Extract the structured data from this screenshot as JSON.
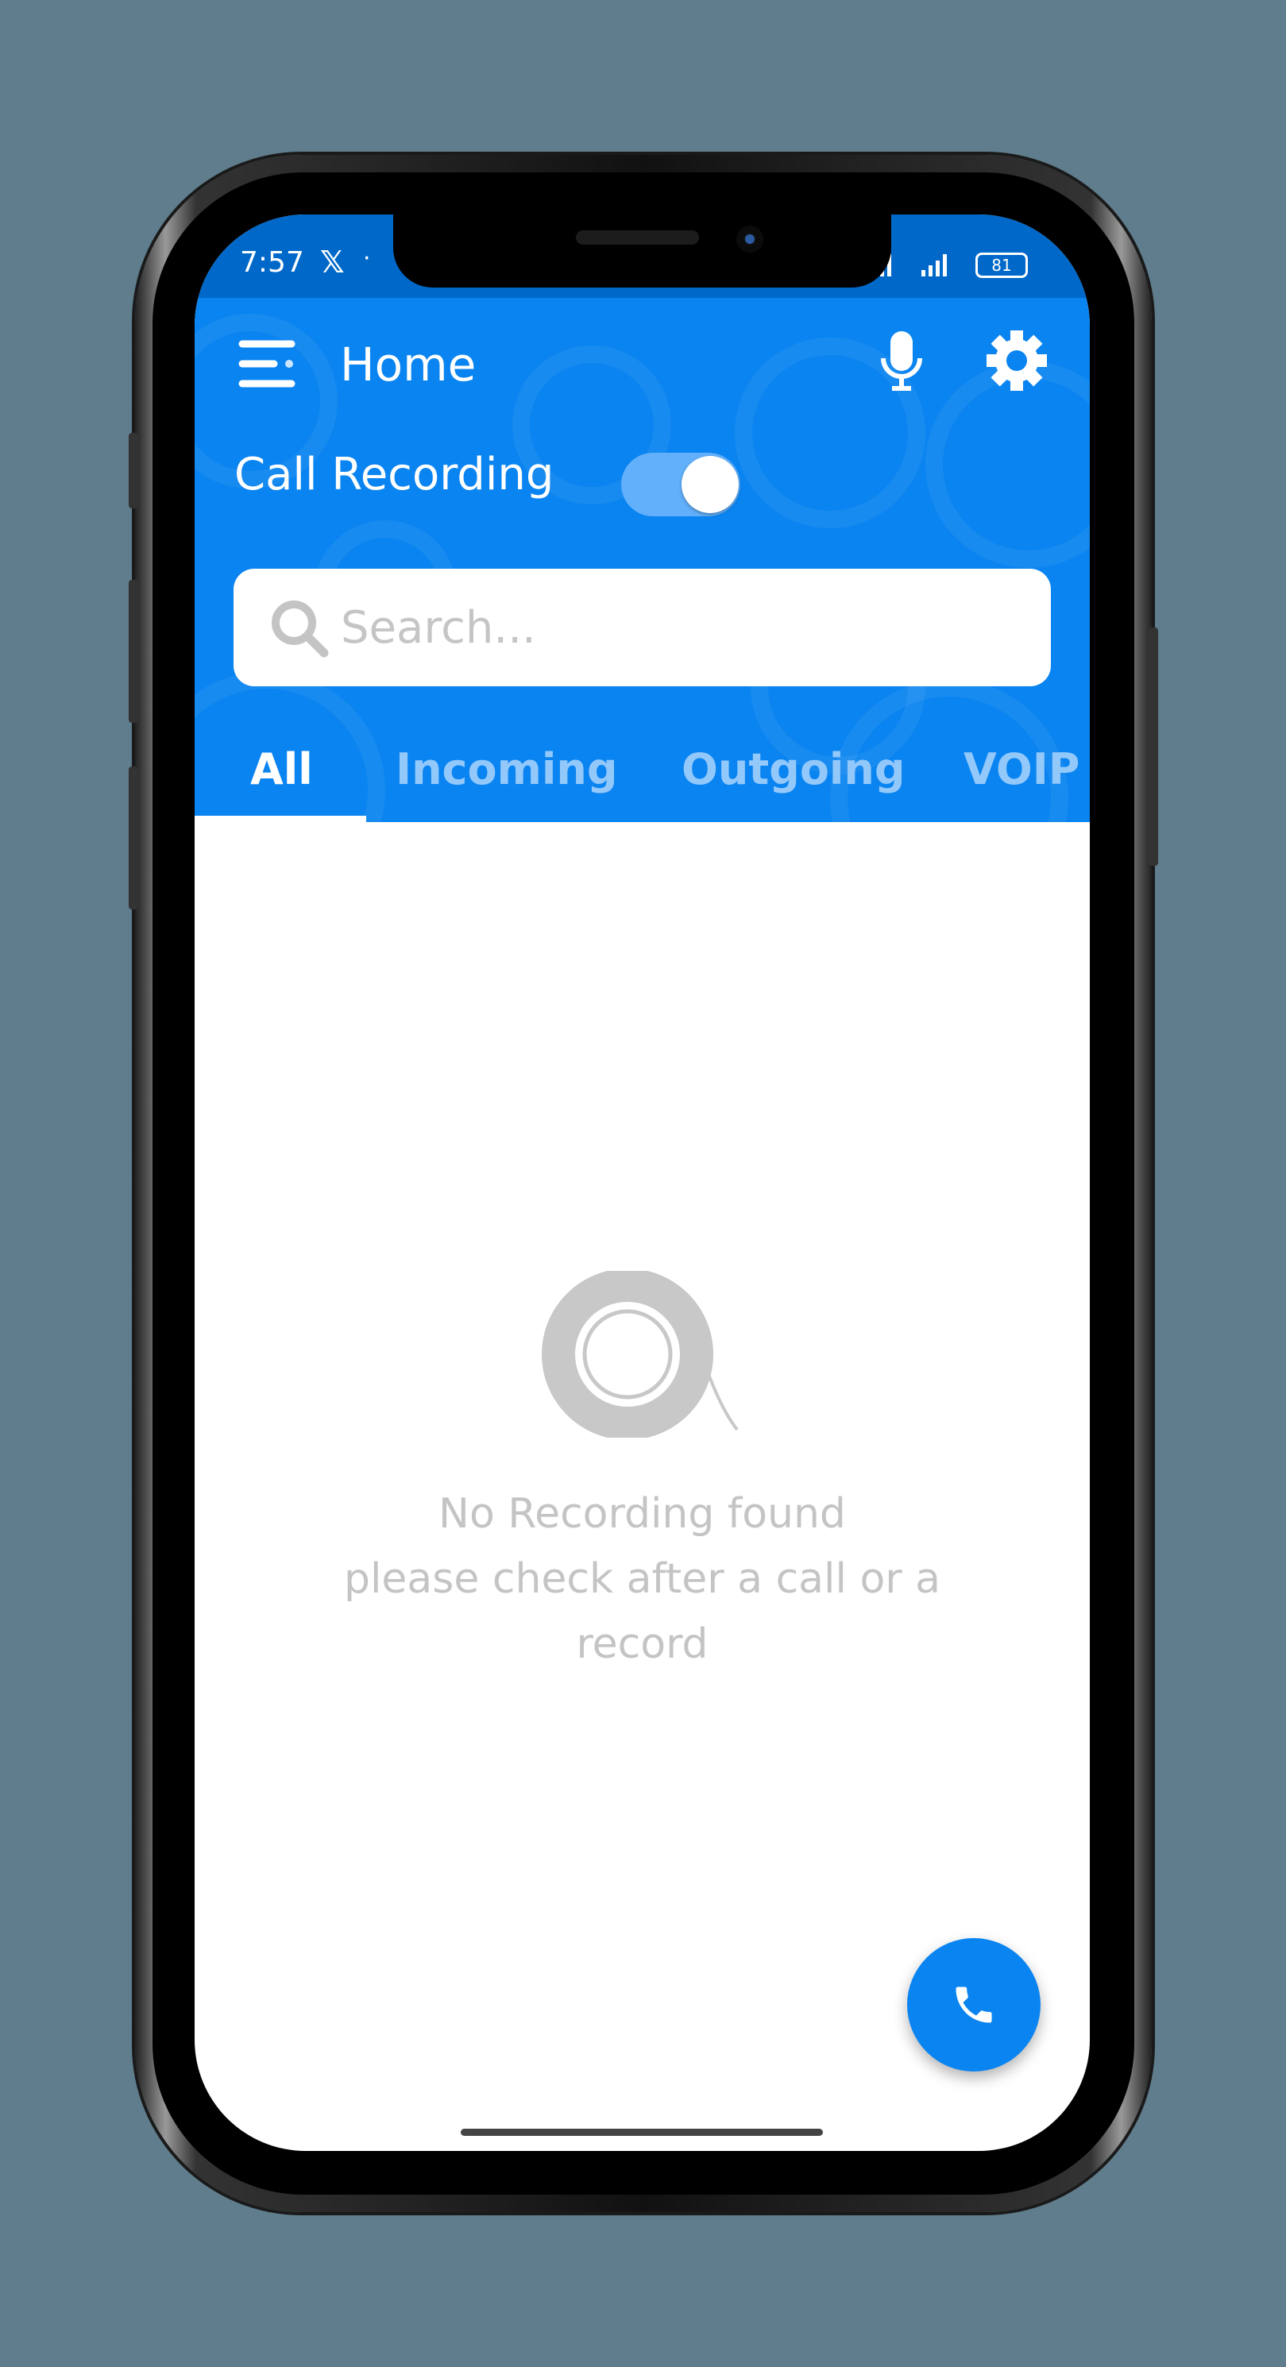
{
  "status_bar": {
    "time": "7:57",
    "notification_icon": "x-logo-icon",
    "battery": "81"
  },
  "header": {
    "title": "Home",
    "menu_icon": "hamburger-icon",
    "mic_icon": "microphone-icon",
    "settings_icon": "gear-icon"
  },
  "call_recording": {
    "label": "Call Recording",
    "enabled": true
  },
  "search": {
    "placeholder": "Search..."
  },
  "tabs": [
    {
      "label": "All",
      "active": true
    },
    {
      "label": "Incoming",
      "active": false
    },
    {
      "label": "Outgoing",
      "active": false
    },
    {
      "label": "VOIP",
      "active": false
    }
  ],
  "empty_state": {
    "line1": "No Recording found",
    "line2": "please check after a call or a",
    "line3": "record"
  },
  "fab": {
    "icon": "phone-icon"
  },
  "colors": {
    "primary": "#0a84f0",
    "status_bar": "#0068c8",
    "empty_text": "#c4c4c4",
    "background": "#5f7d8c"
  }
}
